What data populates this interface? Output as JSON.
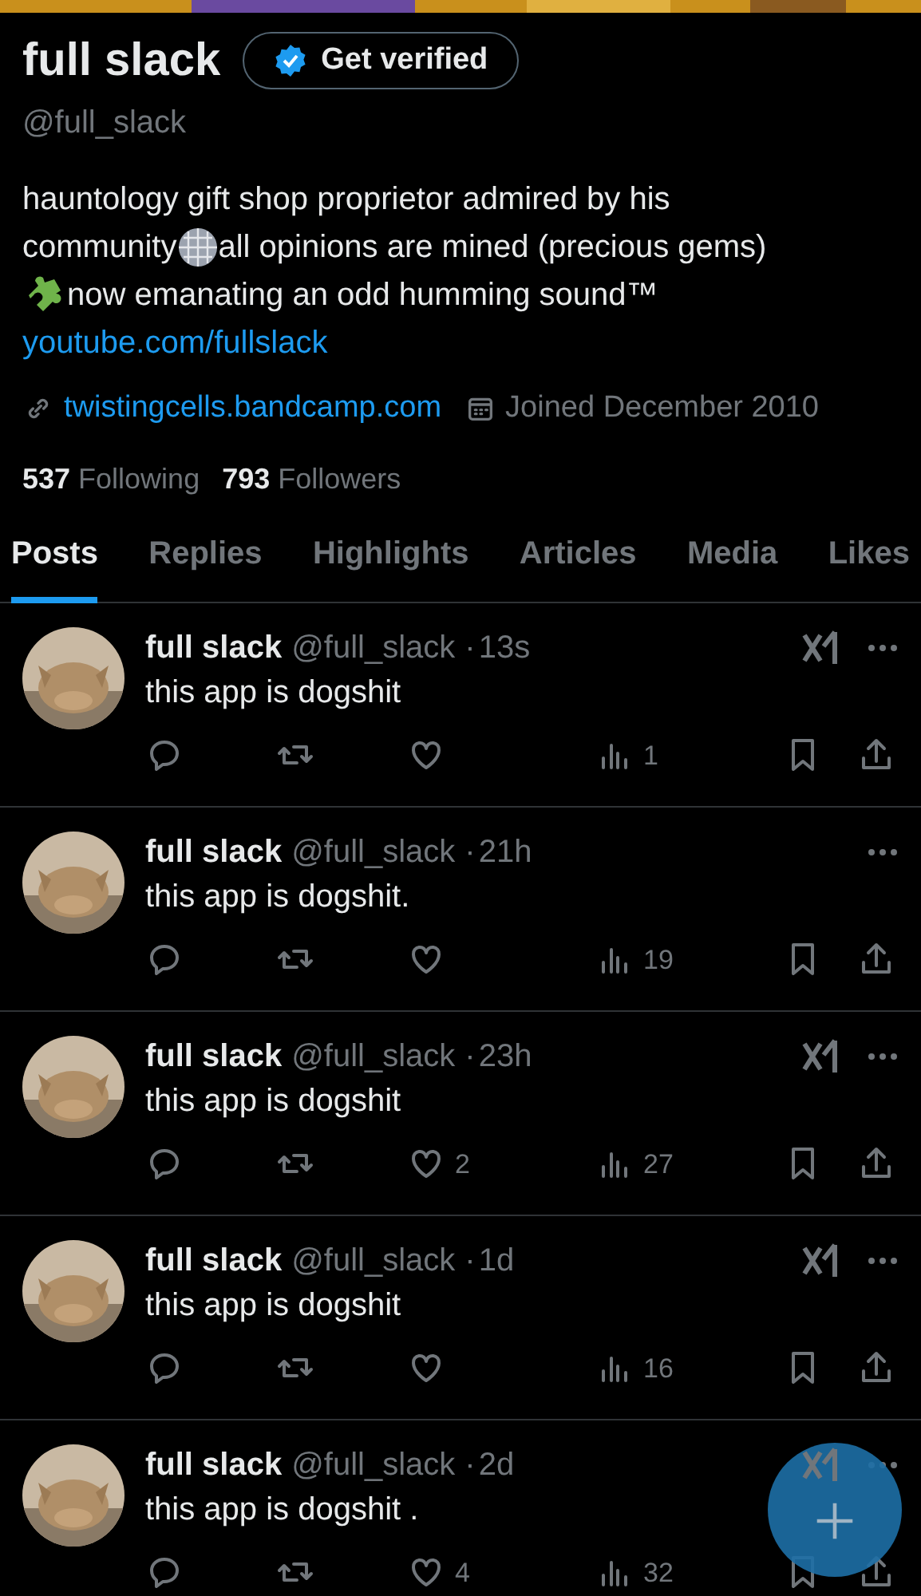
{
  "profile": {
    "name": "full slack",
    "verify_button": "Get verified",
    "handle": "@full_slack",
    "bio": [
      "hauntology gift shop proprietor admired by his",
      "community",
      "all opinions are mined (precious gems)",
      "now emanating an odd humming sound™"
    ],
    "bio_link": "youtube.com/fullslack",
    "website": "twistingcells.bandcamp.com",
    "joined": "Joined December 2010",
    "following_count": "537",
    "following_label": "Following",
    "followers_count": "793",
    "followers_label": "Followers"
  },
  "tabs": [
    {
      "label": "Posts",
      "selected": true
    },
    {
      "label": "Replies",
      "selected": false
    },
    {
      "label": "Highlights",
      "selected": false
    },
    {
      "label": "Articles",
      "selected": false
    },
    {
      "label": "Media",
      "selected": false
    },
    {
      "label": "Likes",
      "selected": false
    }
  ],
  "posts": [
    {
      "name": "full slack",
      "handle": "@full_slack",
      "dot": "·",
      "time": "13s",
      "text": "this app is dogshit",
      "grok": true,
      "views": "1"
    },
    {
      "name": "full slack",
      "handle": "@full_slack",
      "dot": "·",
      "time": "21h",
      "text": "this app is dogshit.",
      "grok": false,
      "views": "19"
    },
    {
      "name": "full slack",
      "handle": "@full_slack",
      "dot": "·",
      "time": "23h",
      "text": "this app is dogshit",
      "grok": true,
      "likes": "2",
      "views": "27"
    },
    {
      "name": "full slack",
      "handle": "@full_slack",
      "dot": "·",
      "time": "1d",
      "text": "this app is dogshit",
      "grok": true,
      "views": "16"
    },
    {
      "name": "full slack",
      "handle": "@full_slack",
      "dot": "·",
      "time": "2d",
      "text": "this app is dogshit .",
      "grok": true,
      "likes": "4",
      "views": "32"
    }
  ]
}
